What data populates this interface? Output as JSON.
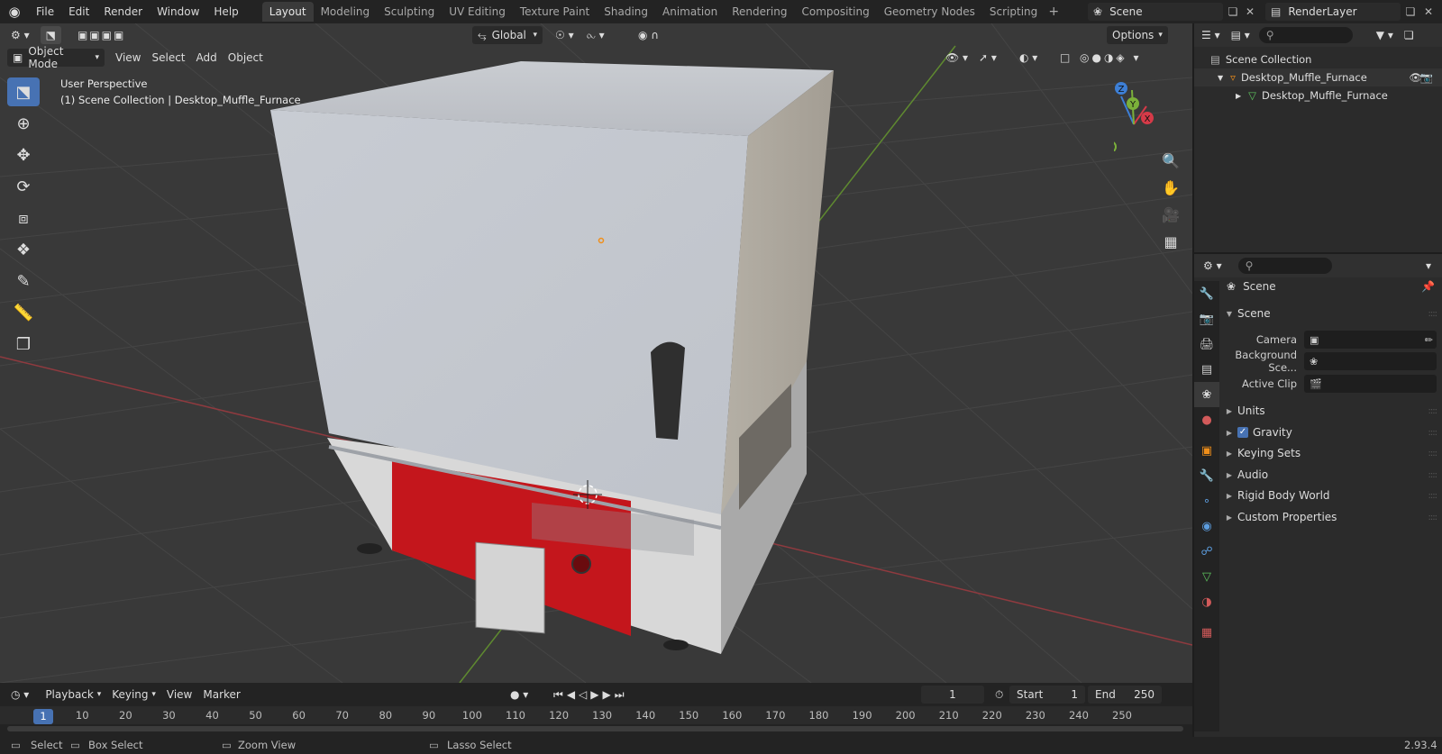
{
  "topbar": {
    "menus": [
      "File",
      "Edit",
      "Render",
      "Window",
      "Help"
    ],
    "workspaces": [
      "Layout",
      "Modeling",
      "Sculpting",
      "UV Editing",
      "Texture Paint",
      "Shading",
      "Animation",
      "Rendering",
      "Compositing",
      "Geometry Nodes",
      "Scripting"
    ],
    "active_workspace": "Layout",
    "scene": "Scene",
    "view_layer": "RenderLayer"
  },
  "viewport": {
    "mode": "Object Mode",
    "menus": [
      "View",
      "Select",
      "Add",
      "Object"
    ],
    "transform_orientation": "Global",
    "options_label": "Options",
    "info_line1": "User Perspective",
    "info_line2": "(1) Scene Collection | Desktop_Muffle_Furnace",
    "gizmo": {
      "x": "X",
      "y": "Y",
      "z": "Z"
    }
  },
  "timeline": {
    "menus": [
      "Playback",
      "Keying",
      "View",
      "Marker"
    ],
    "current_frame": "1",
    "start_label": "Start",
    "start": "1",
    "end_label": "End",
    "end": "250",
    "ruler": [
      "1",
      "10",
      "20",
      "30",
      "40",
      "50",
      "60",
      "70",
      "80",
      "90",
      "100",
      "110",
      "120",
      "130",
      "140",
      "150",
      "160",
      "170",
      "180",
      "190",
      "200",
      "210",
      "220",
      "230",
      "240",
      "250"
    ]
  },
  "statusbar": {
    "select": "Select",
    "box_select": "Box Select",
    "zoom_view": "Zoom View",
    "lasso_select": "Lasso Select",
    "version": "2.93.4"
  },
  "outliner": {
    "root": "Scene Collection",
    "object": "Desktop_Muffle_Furnace",
    "mesh": "Desktop_Muffle_Furnace"
  },
  "properties": {
    "context": "Scene",
    "panel_title": "Scene",
    "camera_label": "Camera",
    "background_label": "Background Sce...",
    "active_clip_label": "Active Clip",
    "units": "Units",
    "gravity": "Gravity",
    "keying_sets": "Keying Sets",
    "audio": "Audio",
    "rigid_body_world": "Rigid Body World",
    "custom_properties": "Custom Properties"
  },
  "colors": {
    "accent": "#4772b3",
    "furnace_red": "#c4161c",
    "axis_x": "#d63a48",
    "axis_y": "#7bb03a",
    "axis_z": "#3d7fd6"
  }
}
